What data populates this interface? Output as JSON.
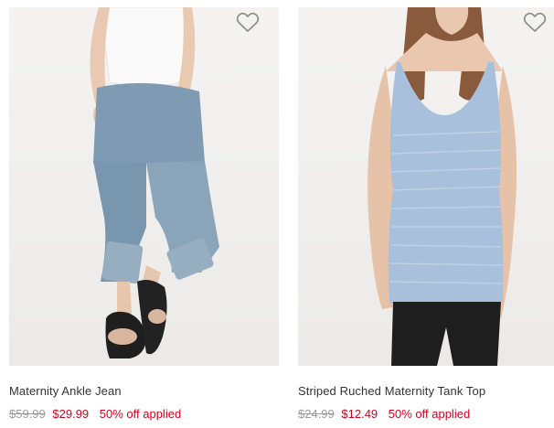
{
  "products": [
    {
      "name": "Maternity Ankle Jean",
      "original_price": "$59.99",
      "sale_price": "$29.99",
      "promo": "50% off applied",
      "favorite_icon": "heart-outline-icon"
    },
    {
      "name": "Striped Ruched Maternity Tank Top",
      "original_price": "$24.99",
      "sale_price": "$12.49",
      "promo": "50% off applied",
      "favorite_icon": "heart-outline-icon"
    }
  ],
  "colors": {
    "sale": "#d0021b",
    "original": "#9a9a9a",
    "name": "#333333",
    "photo_bg": "#f0efed",
    "denim": "#7f9bb3",
    "tank": "#a9c0dc"
  }
}
